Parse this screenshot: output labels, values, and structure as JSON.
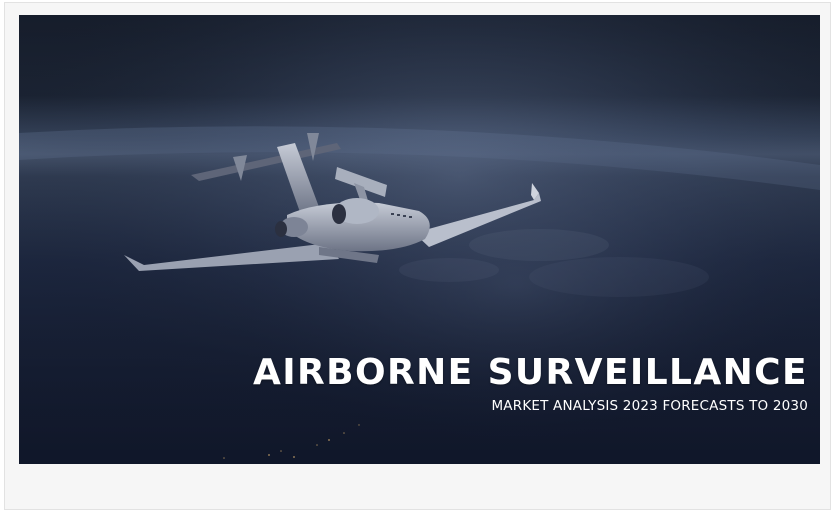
{
  "banner": {
    "title": "AIRBORNE SURVEILLANCE",
    "subtitle": "MARKET ANALYSIS 2023 FORECASTS TO 2030"
  },
  "colors": {
    "sky_top": "#1a2233",
    "horizon_glow": "#6a7f9e",
    "earth": "#1c2840",
    "text": "#ffffff",
    "frame_background": "#f6f6f6"
  },
  "image": {
    "subject": "surveillance-jet-above-earth"
  }
}
